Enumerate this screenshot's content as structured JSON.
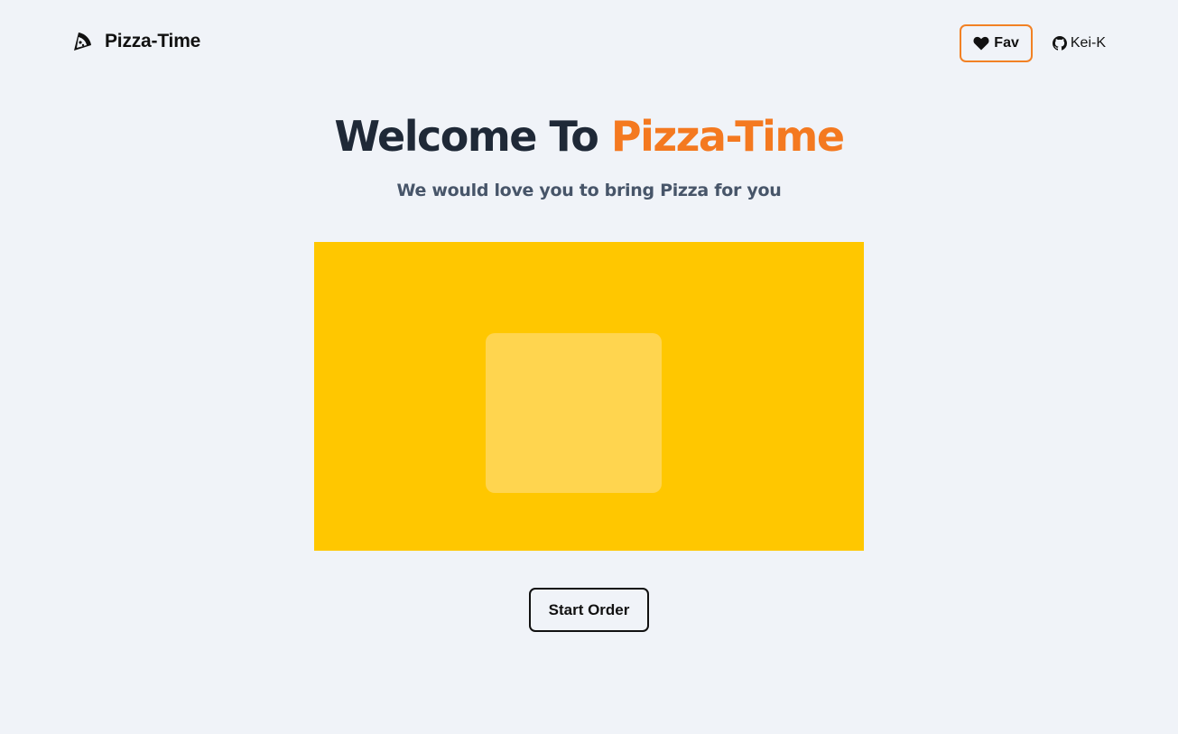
{
  "header": {
    "brand": {
      "name": "Pizza-Time",
      "icon": "pizza-slice-icon"
    },
    "nav": {
      "fav": {
        "label": "Fav",
        "icon": "heart-icon"
      },
      "github": {
        "label": "Kei-K",
        "icon": "github-icon"
      }
    }
  },
  "hero": {
    "title_prefix": "Welcome To ",
    "title_accent": "Pizza-Time",
    "subtitle": "We would love you to bring Pizza for you",
    "cta_label": "Start Order"
  },
  "colors": {
    "accent": "#f47920",
    "background": "#f0f3f8",
    "image_bg": "#ffc700",
    "image_placeholder": "#ffd54f",
    "heading": "#1f2937",
    "subheading": "#475569"
  }
}
